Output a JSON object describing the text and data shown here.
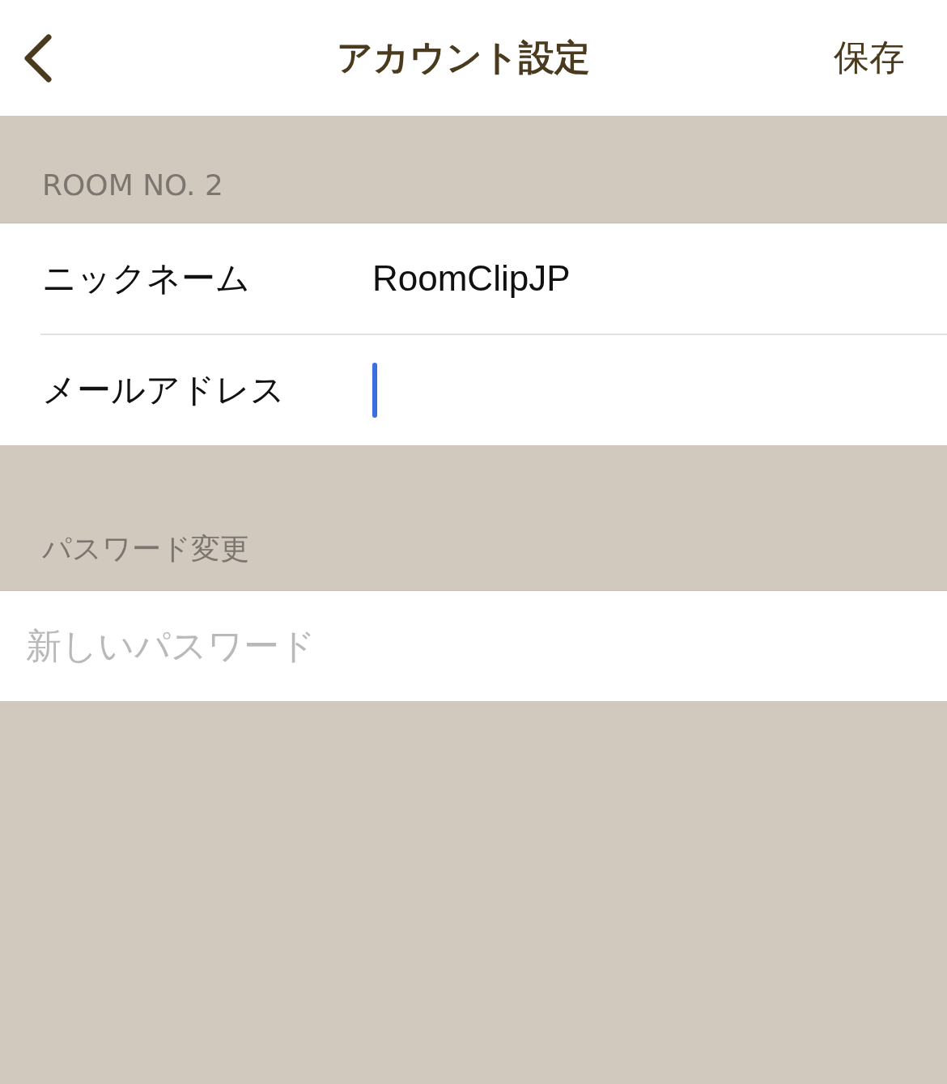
{
  "nav_bar": {
    "title": "アカウント設定",
    "save": "保存"
  },
  "sections": [
    {
      "header": "ROOM NO. 2",
      "rows": [
        {
          "kind": "labeled",
          "label": "ニックネーム",
          "value": "RoomClipJP",
          "focused": false
        },
        {
          "kind": "labeled",
          "label": "メールアドレス",
          "focused": true
        }
      ]
    },
    {
      "header": "パスワード変更",
      "rows": [
        {
          "kind": "plain",
          "placeholder": "新しいパスワード",
          "focused": false
        }
      ]
    }
  ]
}
